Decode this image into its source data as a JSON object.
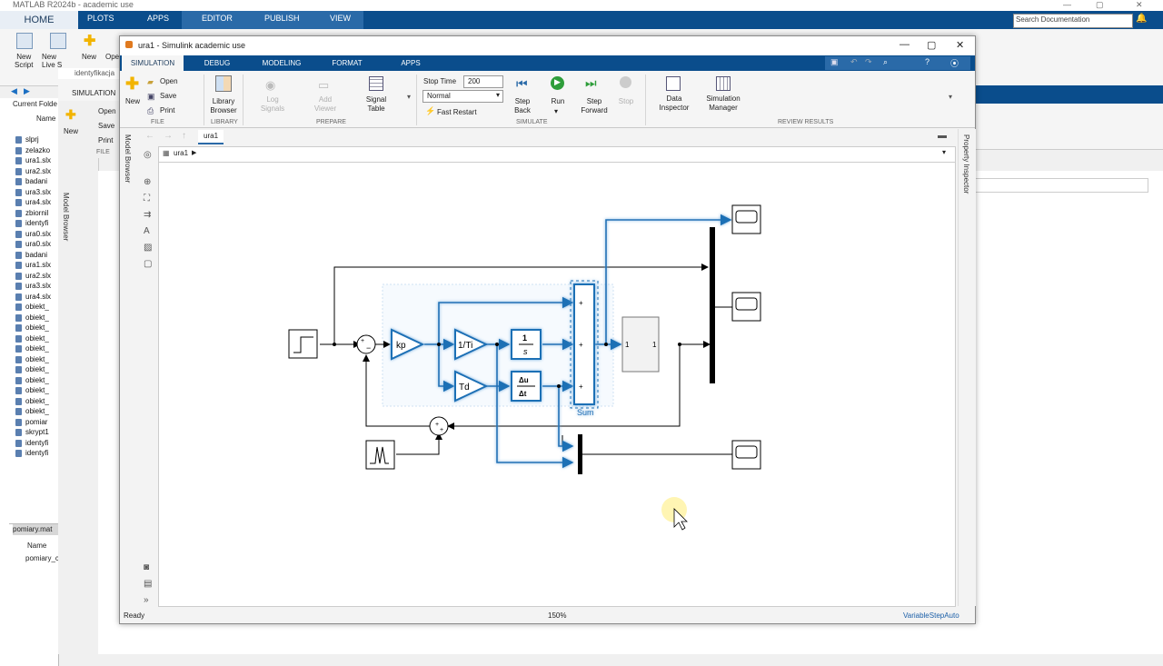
{
  "matlab": {
    "title": "MATLAB R2024b - academic use",
    "tabs": [
      "HOME",
      "PLOTS",
      "APPS",
      "EDITOR",
      "PUBLISH",
      "VIEW"
    ],
    "search_placeholder": "Search Documentation",
    "toolstrip": {
      "new_script": "New\nScript",
      "new_live": "New\nLive S",
      "new": "New",
      "open": "Ope"
    },
    "current_folder_label": "Current Folde",
    "name_header": "Name",
    "files": [
      "slprj",
      "zelazko",
      "ura1.slx",
      "ura2.slx",
      "badani",
      "ura3.slx",
      "ura4.slx",
      "zbiornil",
      "identyfi",
      "ura0.slx",
      "ura0.slx",
      "badani",
      "ura1.slx",
      "ura2.slx",
      "ura3.slx",
      "ura4.slx",
      "obiekt_",
      "obiekt_",
      "obiekt_",
      "obiekt_",
      "obiekt_",
      "obiekt_",
      "obiekt_",
      "obiekt_",
      "obiekt_",
      "obiekt_",
      "obiekt_",
      "pomiar",
      "skrypt1",
      "identyfi",
      "identyfi"
    ],
    "workspace_file": "pomiary.mat",
    "workspace_name_header": "Name",
    "workspace_var": "pomiary_c"
  },
  "second_window": {
    "tab_label": "identyfikacja",
    "section": "SIMULATION",
    "new": "New",
    "open": "Open",
    "save": "Save",
    "print": "Print",
    "file_group": "FILE",
    "model_browser": "Model Browser"
  },
  "simulink": {
    "title": "ura1 - Simulink academic use",
    "tabs": [
      "SIMULATION",
      "DEBUG",
      "MODELING",
      "FORMAT",
      "APPS"
    ],
    "file": {
      "new": "New",
      "open": "Open",
      "save": "Save",
      "print": "Print",
      "group": "FILE"
    },
    "library": {
      "label": "Library\nBrowser",
      "group": "LIBRARY"
    },
    "prepare": {
      "log": "Log\nSignals",
      "viewer": "Add\nViewer",
      "table": "Signal\nTable",
      "group": "PREPARE"
    },
    "simulate": {
      "stop_time_label": "Stop Time",
      "stop_time_value": "200",
      "mode": "Normal",
      "fast_restart": "Fast Restart",
      "step_back": "Step\nBack",
      "run": "Run",
      "step_forward": "Step\nForward",
      "stop": "Stop",
      "group": "SIMULATE"
    },
    "review": {
      "data_inspector": "Data\nInspector",
      "sim_manager": "Simulation\nManager",
      "group": "REVIEW RESULTS"
    },
    "model_name": "ura1",
    "breadcrumb": "ura1",
    "model_browser": "Model Browser",
    "property_inspector": "Property Inspector",
    "status": {
      "left": "Ready",
      "zoom": "150%",
      "solver": "VariableStepAuto"
    }
  },
  "diagram": {
    "gain_kp": "kp",
    "gain_ti": "1/Ti",
    "gain_td": "Td",
    "integrator_num": "1",
    "integrator_den": "s",
    "deriv_num": "Δu",
    "deriv_den": "Δt",
    "sum_label": "Sum",
    "subsystem_in": "1",
    "subsystem_out": "1",
    "sum_signs": [
      "+",
      "−"
    ],
    "plus": "+"
  },
  "colors": {
    "matlab_blue": "#0a4d8c",
    "selection": "#1f6fb5",
    "selection_glow": "#9ec7ea"
  }
}
